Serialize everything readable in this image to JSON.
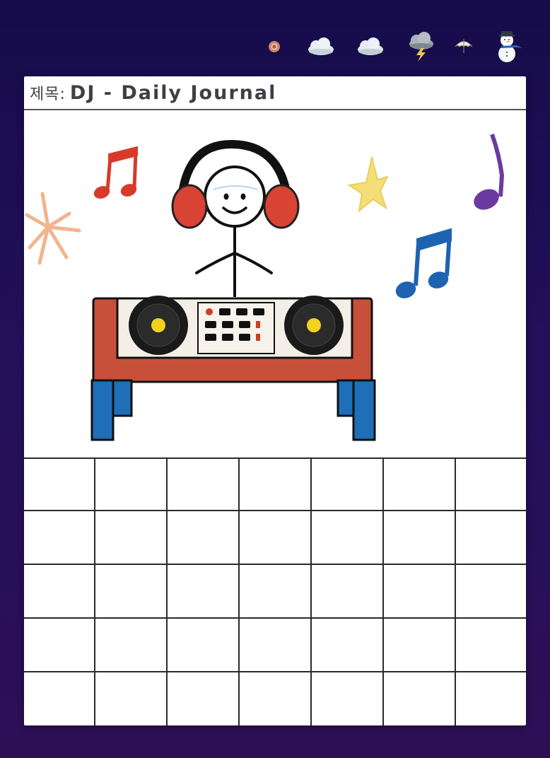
{
  "journal": {
    "title_label": "제목:",
    "title": "DJ - Daily Journal"
  },
  "weather": {
    "options": [
      {
        "icon": "sun-icon",
        "selected": false
      },
      {
        "icon": "cloud-icon",
        "selected": false
      },
      {
        "icon": "cloud-icon",
        "selected": false
      },
      {
        "icon": "storm-cloud-icon",
        "selected": false
      },
      {
        "icon": "umbrella-icon",
        "selected": false
      },
      {
        "icon": "snowman-icon",
        "selected": false
      }
    ]
  },
  "writing_grid": {
    "rows": 5,
    "columns": 7
  },
  "colors": {
    "background": "#1e0f50",
    "paper": "#ffffff",
    "note_red": "#d83a2a",
    "note_blue": "#1e63b0",
    "note_purple": "#6b3aa0",
    "star_yellow": "#f3de78",
    "burst_peach": "#f2b48c",
    "headphone_red": "#d94334",
    "desk_red": "#c8503a",
    "leg_blue": "#1f6fb8"
  }
}
